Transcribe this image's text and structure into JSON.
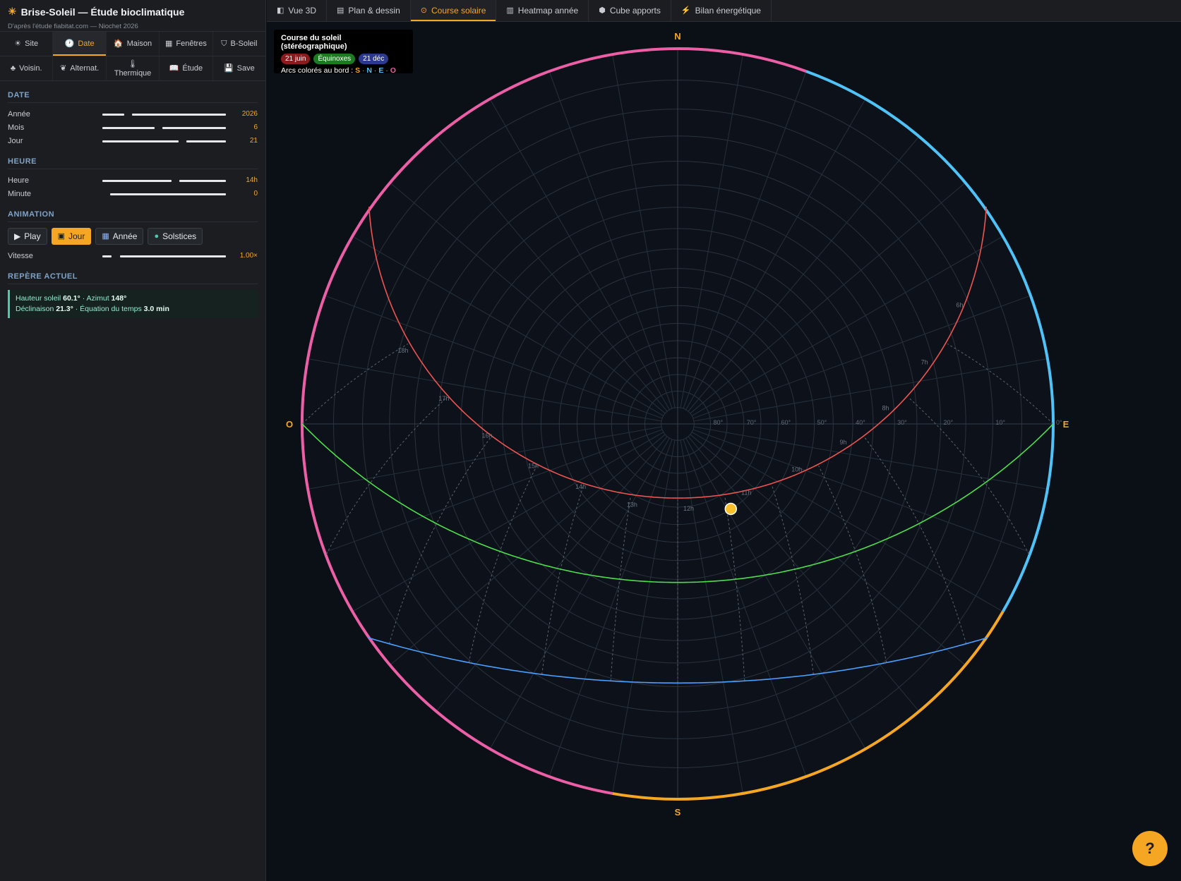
{
  "app": {
    "title": "Brise-Soleil — Étude bioclimatique",
    "subtitle": "D'après l'étude fiabitat.com — Niochet 2026"
  },
  "side_tabs": {
    "row1": [
      {
        "label": "Site",
        "icon": "sun-icon",
        "glyph": "☀"
      },
      {
        "label": "Date",
        "icon": "clock-icon",
        "glyph": "🕐"
      },
      {
        "label": "Maison",
        "icon": "house-icon",
        "glyph": "🏠"
      },
      {
        "label": "Fenêtres",
        "icon": "window-icon",
        "glyph": "▦"
      },
      {
        "label": "B-Soleil",
        "icon": "shield-icon",
        "glyph": "⛉"
      }
    ],
    "row2": [
      {
        "label": "Voisin.",
        "icon": "tree-icon",
        "glyph": "♣"
      },
      {
        "label": "Alternat.",
        "icon": "leaf-icon",
        "glyph": "❦"
      },
      {
        "label": "Thermique",
        "icon": "thermometer-icon",
        "glyph": "🌡"
      },
      {
        "label": "Étude",
        "icon": "book-icon",
        "glyph": "📖"
      },
      {
        "label": "Save",
        "icon": "save-icon",
        "glyph": "💾"
      }
    ]
  },
  "date_section": {
    "title": "DATE",
    "year": {
      "label": "Année",
      "value": "2026"
    },
    "month": {
      "label": "Mois",
      "value": "6"
    },
    "day": {
      "label": "Jour",
      "value": "21"
    }
  },
  "time_section": {
    "title": "HEURE",
    "hour": {
      "label": "Heure",
      "value": "14h"
    },
    "minute": {
      "label": "Minute",
      "value": "0"
    }
  },
  "animation_section": {
    "title": "ANIMATION",
    "buttons": {
      "play": "Play",
      "day": "Jour",
      "year": "Année",
      "solstices": "Solstices"
    },
    "speed": {
      "label": "Vitesse",
      "value": "1.00×"
    }
  },
  "current_section": {
    "title": "REPÈRE ACTUEL",
    "sun_height_label": "Hauteur soleil",
    "sun_height": "60.1°",
    "azimuth_label": "· Azimut",
    "azimuth": "148°",
    "declination_label": "Déclinaison",
    "declination": "21.3°",
    "equation_label": "· Équation du temps",
    "equation": "3.0 min"
  },
  "top_tabs": [
    {
      "label": "Vue 3D",
      "icon": "cube-icon",
      "glyph": "◧",
      "active": false
    },
    {
      "label": "Plan & dessin",
      "icon": "map-icon",
      "glyph": "▤",
      "active": false
    },
    {
      "label": "Course solaire",
      "icon": "target-icon",
      "glyph": "⊙",
      "active": true
    },
    {
      "label": "Heatmap année",
      "icon": "bar-chart-icon",
      "glyph": "▥",
      "active": false
    },
    {
      "label": "Cube apports",
      "icon": "box-icon",
      "glyph": "⬢",
      "active": false
    },
    {
      "label": "Bilan énergétique",
      "icon": "lightning-icon",
      "glyph": "⚡",
      "active": false
    }
  ],
  "legend": {
    "title": "Course du soleil (stéréographique)",
    "pills": [
      {
        "label": "21 juin",
        "color": "#8c1c1c"
      },
      {
        "label": "Équinoxes",
        "color": "#1d7a22"
      },
      {
        "label": "21 déc",
        "color": "#2b3a8c"
      }
    ],
    "note": "Arcs colorés au bord :",
    "letters": [
      {
        "l": "S",
        "color": "#f5a623"
      },
      {
        "l": "N",
        "color": "#4fc3f7"
      },
      {
        "l": "E",
        "color": "#4fc3f7"
      },
      {
        "l": "O",
        "color": "#ec5fa6"
      }
    ]
  },
  "chart_data": {
    "type": "polar-stereographic",
    "title": "Course du soleil (stéréographique)",
    "cardinals": {
      "N": "N",
      "S": "S",
      "E": "E",
      "O": "O"
    },
    "altitude_ticks": [
      "80°",
      "70°",
      "60°",
      "50°",
      "40°",
      "30°",
      "20°",
      "10°",
      "0°"
    ],
    "altitude_values": [
      80,
      70,
      60,
      50,
      40,
      30,
      20,
      10,
      0
    ],
    "colors": {
      "north": "#4fc3f7",
      "south": "#f5a623",
      "west": "#ec5fa6",
      "summer": "#ef5350",
      "equinox": "#4cdf4c",
      "winter": "#4a9fff",
      "sun": "#f7c02b"
    },
    "summer_hour_labels": [
      {
        "label": "6h",
        "az": 68,
        "alt": 12
      },
      {
        "label": "7h",
        "az": 77,
        "alt": 22
      },
      {
        "label": "8h",
        "az": 87,
        "alt": 32
      },
      {
        "label": "9h",
        "az": 98,
        "alt": 42
      },
      {
        "label": "10h",
        "az": 113,
        "alt": 52
      },
      {
        "label": "11h",
        "az": 137,
        "alt": 60
      },
      {
        "label": "12h",
        "az": 173,
        "alt": 63
      },
      {
        "label": "13h",
        "az": 208,
        "alt": 61
      },
      {
        "label": "14h",
        "az": 235,
        "alt": 55
      },
      {
        "label": "15h",
        "az": 252,
        "alt": 46
      },
      {
        "label": "16h",
        "az": 265,
        "alt": 36
      },
      {
        "label": "17h",
        "az": 275,
        "alt": 26
      },
      {
        "label": "18h",
        "az": 284,
        "alt": 16
      }
    ],
    "current_sun": {
      "altitude": 60.1,
      "azimuth": 148
    }
  }
}
